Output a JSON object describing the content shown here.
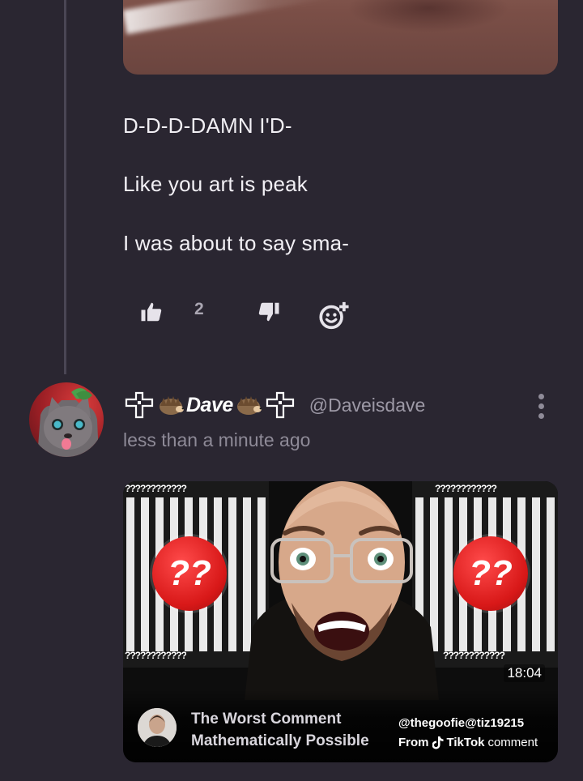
{
  "parent_comment": {
    "lines": [
      "D-D-D-DAMN I'D-",
      "Like you art is peak",
      "I was about to say sma-"
    ],
    "like_count": "2"
  },
  "reply": {
    "display_name": "Dave",
    "handle": "@Daveisdave",
    "timestamp": "less than a minute ago",
    "video": {
      "duration": "18:04",
      "title_line1": "The Worst Comment",
      "title_line2": "Mathematically Possible",
      "source_handle": "@thegoofie@tiz19215",
      "credit_from": "From",
      "credit_brand": "TikTok",
      "credit_suffix": "comment",
      "question_marks": "??",
      "question_row": "????????????"
    }
  },
  "colors": {
    "background": "#2a2631",
    "muted_text": "#8e8a97",
    "thread_line": "#4a4654",
    "badge_red": "#d81818"
  },
  "icons": [
    "thumbs-up-icon",
    "thumbs-down-icon",
    "add-reaction-icon",
    "more-vertical-icon",
    "cross-emblem-icon",
    "hedgehog-icon",
    "tiktok-logo-icon"
  ]
}
